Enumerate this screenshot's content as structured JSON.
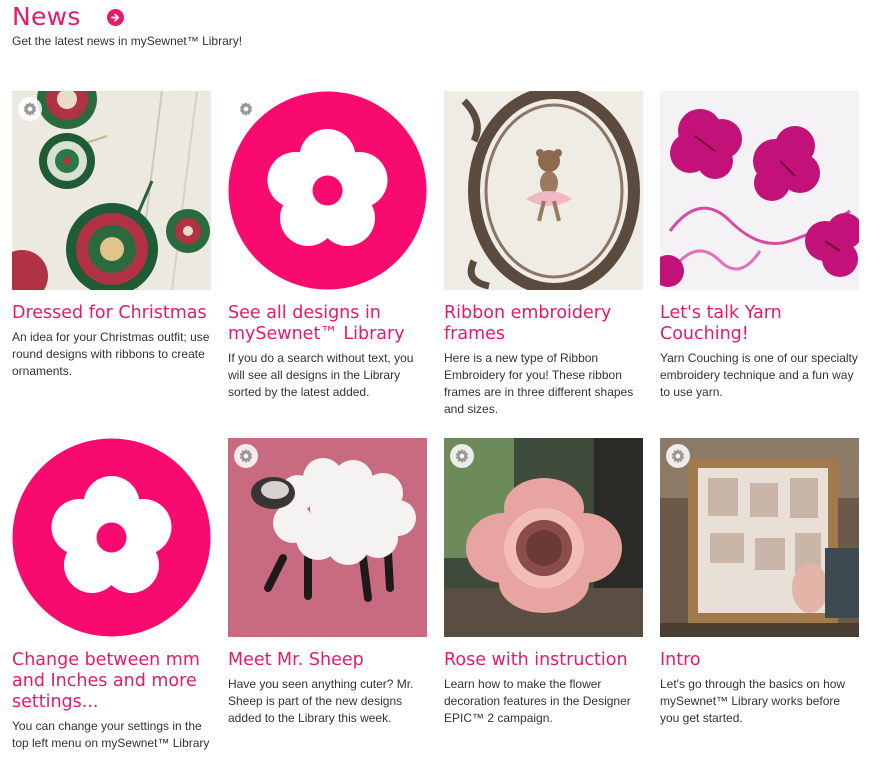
{
  "header": {
    "title": "News",
    "subtitle": "Get the latest news in mySewnet™ Library!"
  },
  "colors": {
    "accent": "#e6196b"
  },
  "cards": [
    {
      "title": "Dressed for Christmas",
      "desc": "An idea for your Christmas outfit; use round designs with ribbons to create ornaments.",
      "icon": "settings-gear"
    },
    {
      "title": "See all designs in mySewnet™ Library",
      "desc": "If you do a search without text, you will see all designs in the Library sorted by the latest added.",
      "icon": "settings-gear"
    },
    {
      "title": "Ribbon embroidery frames",
      "desc": "Here is a new type of Ribbon Embroidery for you! These ribbon frames are in three different shapes and sizes."
    },
    {
      "title": "Let's talk Yarn Couching!",
      "desc": "Yarn Couching is one of our specialty embroidery technique and a fun way to use yarn."
    },
    {
      "title": "Change between mm and Inches and more settings...",
      "desc": "You can change your settings in the top left menu on mySewnet™ Library"
    },
    {
      "title": "Meet Mr. Sheep",
      "desc": "Have you seen anything cuter? Mr. Sheep is part of the new designs added to the Library this week.",
      "icon": "settings-gear"
    },
    {
      "title": "Rose with instruction",
      "desc": "Learn how to make the flower decoration features in the Designer EPIC™ 2 campaign.",
      "icon": "settings-gear"
    },
    {
      "title": "Intro",
      "desc": "Let's go through the basics on how mySewnet™ Library works before you get started.",
      "icon": "settings-gear"
    }
  ]
}
